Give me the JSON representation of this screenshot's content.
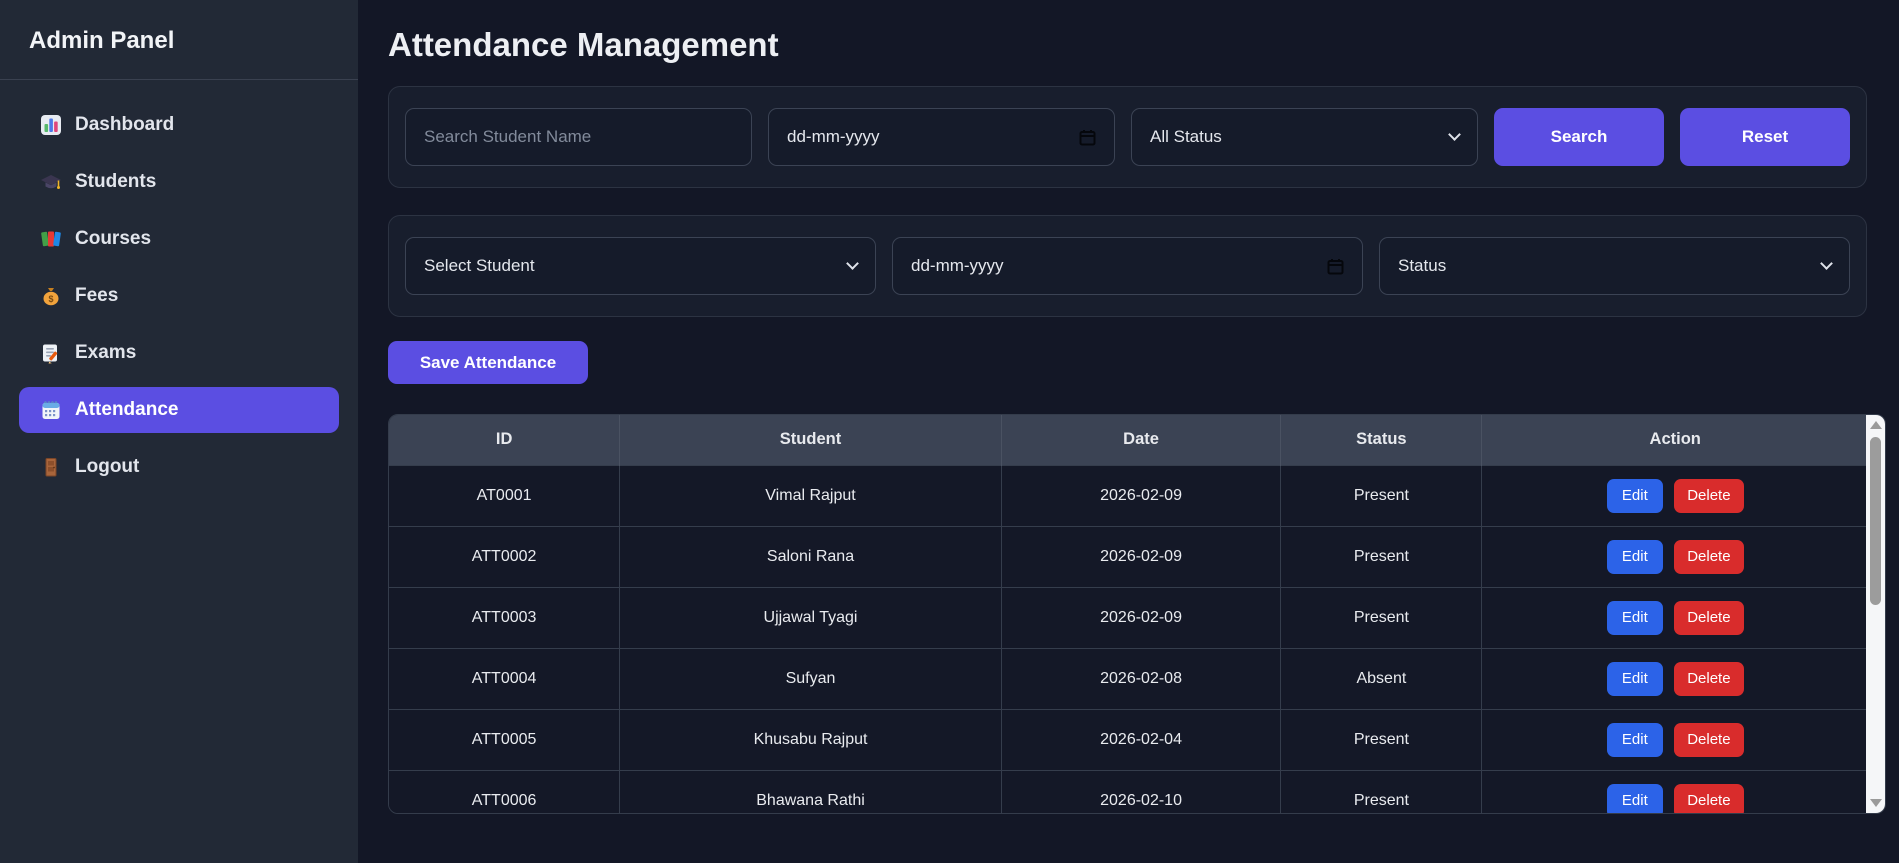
{
  "sidebar": {
    "title": "Admin Panel",
    "items": [
      {
        "label": "Dashboard",
        "icon": "bar-chart-icon",
        "active": false
      },
      {
        "label": "Students",
        "icon": "graduation-cap-icon",
        "active": false
      },
      {
        "label": "Courses",
        "icon": "books-icon",
        "active": false
      },
      {
        "label": "Fees",
        "icon": "money-bag-icon",
        "active": false
      },
      {
        "label": "Exams",
        "icon": "memo-icon",
        "active": false
      },
      {
        "label": "Attendance",
        "icon": "calendar-icon",
        "active": true
      },
      {
        "label": "Logout",
        "icon": "door-icon",
        "active": false
      }
    ]
  },
  "main": {
    "title": "Attendance Management",
    "filter_bar": {
      "search_placeholder": "Search Student Name",
      "date_placeholder": "dd-mm-yyyy",
      "status_select_value": "All Status",
      "search_button_label": "Search",
      "reset_button_label": "Reset"
    },
    "mark_bar": {
      "student_select_value": "Select Student",
      "date_placeholder": "dd-mm-yyyy",
      "status_select_value": "Status",
      "save_button_label": "Save Attendance"
    },
    "table": {
      "columns": [
        "ID",
        "Student",
        "Date",
        "Status",
        "Action"
      ],
      "edit_label": "Edit",
      "delete_label": "Delete",
      "rows": [
        {
          "id": "AT0001",
          "student": "Vimal Rajput",
          "date": "2026-02-09",
          "status": "Present"
        },
        {
          "id": "ATT0002",
          "student": "Saloni Rana",
          "date": "2026-02-09",
          "status": "Present"
        },
        {
          "id": "ATT0003",
          "student": "Ujjawal Tyagi",
          "date": "2026-02-09",
          "status": "Present"
        },
        {
          "id": "ATT0004",
          "student": "Sufyan",
          "date": "2026-02-08",
          "status": "Absent"
        },
        {
          "id": "ATT0005",
          "student": "Khusabu Rajput",
          "date": "2026-02-04",
          "status": "Present"
        },
        {
          "id": "ATT0006",
          "student": "Bhawana Rathi",
          "date": "2026-02-10",
          "status": "Present"
        }
      ]
    }
  },
  "colors": {
    "accent_purple": "#5b4ee2",
    "edit_blue": "#2c63e8",
    "delete_red": "#d92c2c",
    "table_header_bg": "#3b4354",
    "sidebar_bg": "#222936",
    "main_bg": "#131726"
  }
}
